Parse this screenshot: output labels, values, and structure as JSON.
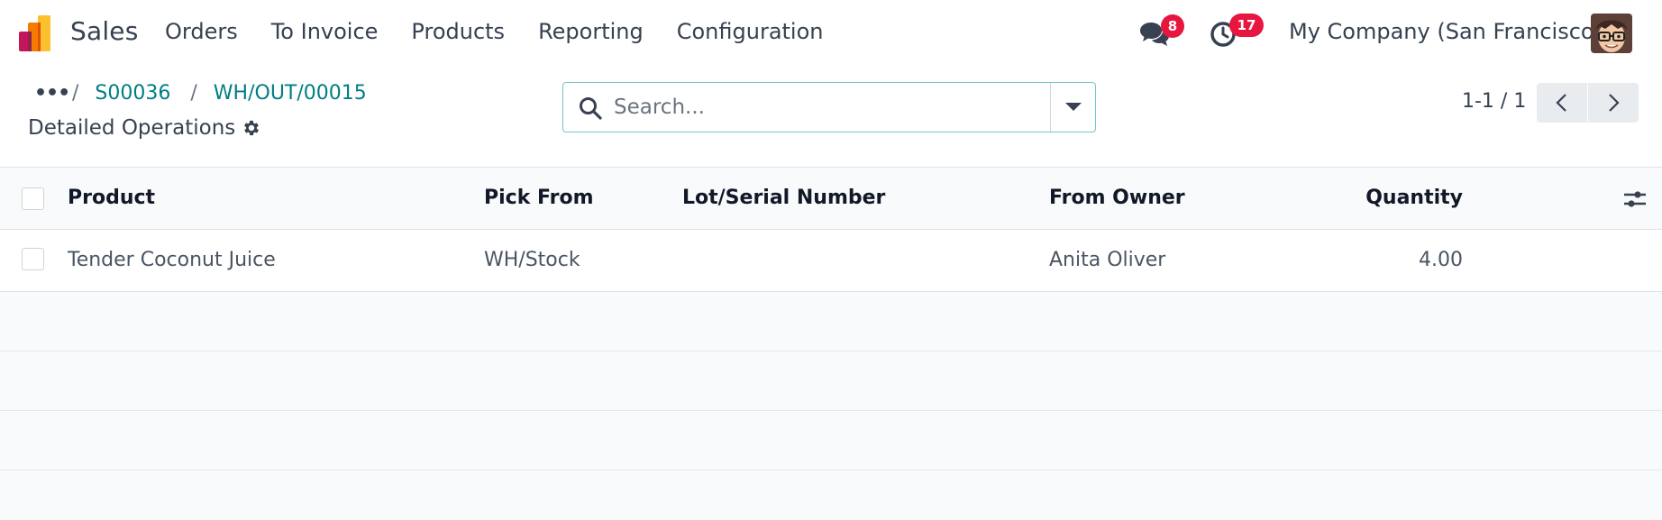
{
  "navbar": {
    "app_name": "Sales",
    "menu": [
      "Orders",
      "To Invoice",
      "Products",
      "Reporting",
      "Configuration"
    ],
    "messages_count": "8",
    "activities_count": "17",
    "company": "My Company (San Francisco)"
  },
  "breadcrumb": {
    "dots": "•••",
    "items": [
      "S00036",
      "WH/OUT/00015"
    ]
  },
  "page_title": "Detailed Operations",
  "search": {
    "placeholder": "Search..."
  },
  "pager": {
    "value": "1-1 / 1"
  },
  "table": {
    "columns": [
      "Product",
      "Pick From",
      "Lot/Serial Number",
      "From Owner",
      "Quantity"
    ],
    "rows": [
      {
        "product": "Tender Coconut Juice",
        "pick_from": "WH/Stock",
        "lot": "",
        "owner": "Anita Oliver",
        "quantity": "4.00"
      }
    ]
  },
  "colors": {
    "accent": "#017e84",
    "badge": "#e8163f",
    "text": "#374151"
  },
  "icons": [
    "app-logo-icon",
    "chat-icon",
    "clock-icon",
    "search-icon",
    "caret-down-icon",
    "gear-icon",
    "chevron-left-icon",
    "chevron-right-icon",
    "sliders-icon"
  ]
}
